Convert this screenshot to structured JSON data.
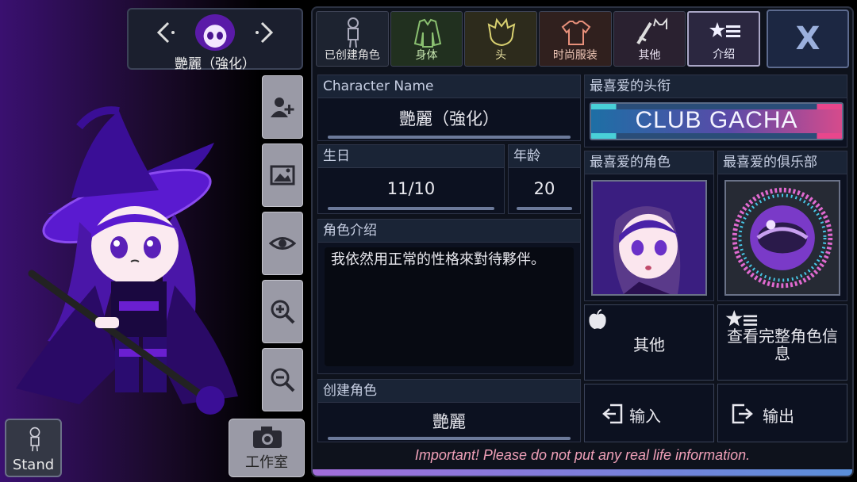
{
  "character_nav": {
    "name": "艷麗（強化）"
  },
  "tools": [
    {
      "icon": "add-user-icon"
    },
    {
      "icon": "image-icon"
    },
    {
      "icon": "eye-icon"
    },
    {
      "icon": "zoom-in-icon"
    },
    {
      "icon": "zoom-out-icon"
    }
  ],
  "stand_button": {
    "label": "Stand"
  },
  "studio_button": {
    "label": "工作室"
  },
  "tabs": [
    {
      "label": "已创建角色",
      "icon": "person-icon"
    },
    {
      "label": "身体",
      "icon": "jacket-icon"
    },
    {
      "label": "头",
      "icon": "hair-icon"
    },
    {
      "label": "时尚服装",
      "icon": "shirt-icon"
    },
    {
      "label": "其他",
      "icon": "sword-cat-icon"
    },
    {
      "label": "介绍",
      "icon": "star-list-icon"
    }
  ],
  "close_button": {
    "label": "X"
  },
  "profile": {
    "name_label": "Character Name",
    "name_value": "艷麗（強化）",
    "birthday_label": "生日",
    "birthday_value": "11/10",
    "age_label": "年龄",
    "age_value": "20",
    "intro_label": "角色介绍",
    "intro_value": "我依然用正常的性格來對待夥伴。",
    "creator_label": "创建角色",
    "creator_value": "艷麗"
  },
  "favorites": {
    "title_label": "最喜爱的头衔",
    "title_value": "CLUB GACHA",
    "character_label": "最喜爱的角色",
    "club_label": "最喜爱的俱乐部"
  },
  "actions": {
    "other": "其他",
    "view_full": "查看完整角色信息",
    "import": "输入",
    "export": "输出"
  },
  "footer": {
    "note": "Important! Please do not put any real life information."
  },
  "colors": {
    "accent_purple": "#6a1fd0",
    "panel_bg": "#0e121c",
    "note_pink": "#f0a0b8"
  }
}
